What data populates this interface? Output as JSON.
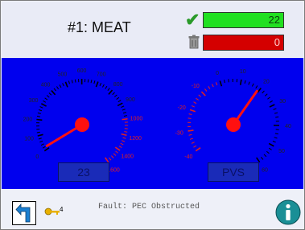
{
  "header": {
    "title": "#1: MEAT",
    "good_count": "22",
    "reject_count": "0",
    "good_color": "#21e021",
    "reject_color": "#d40000",
    "icons": [
      "checkmark-icon",
      "trash-icon"
    ]
  },
  "gauges": {
    "left": {
      "scale_labels": [
        "0",
        "100",
        "200",
        "300",
        "400",
        "500",
        "600",
        "700",
        "800",
        "900",
        "1000",
        "1200",
        "1400",
        "1600"
      ],
      "value": 23,
      "readout": "23"
    },
    "right": {
      "scale_labels": [
        "-40",
        "-30",
        "-20",
        "-10",
        "0",
        "10",
        "20",
        "30",
        "40",
        "50",
        "60"
      ],
      "readout": "PVS"
    }
  },
  "footer": {
    "key_count": "4",
    "fault_message": "Fault: PEC Obstructed",
    "icons": [
      "back-arrow-icon",
      "key-icon",
      "info-icon"
    ]
  },
  "colors": {
    "panel_bg": "#0000ee",
    "needle": "#ff1010",
    "dial_ticks": "#000000"
  }
}
